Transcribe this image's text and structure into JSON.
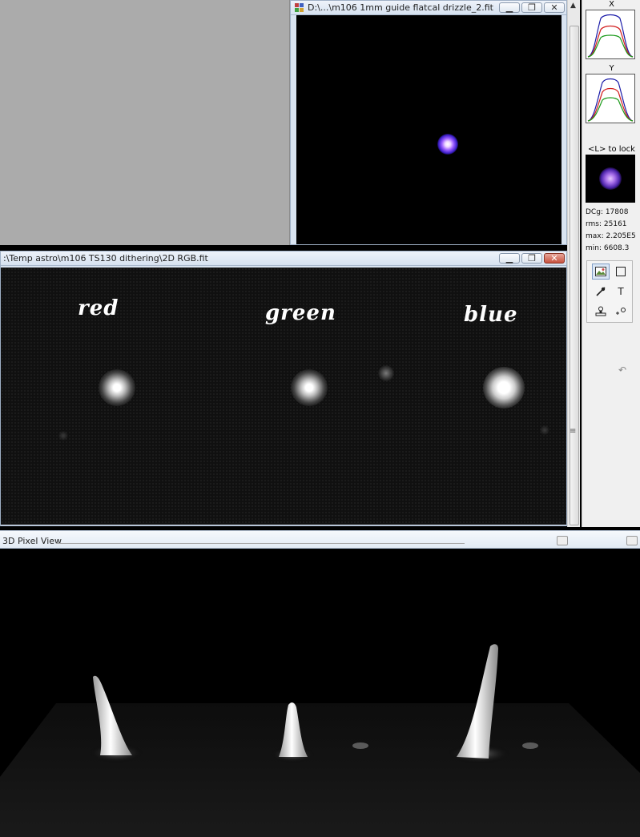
{
  "drizzle_window": {
    "title": "D:\\...\\m106 1mm guide flatcal drizzle_2.fit",
    "minimize_icon": "minimize-icon",
    "maximize_icon": "maximize-icon",
    "close_icon": "close-icon"
  },
  "rgb_window": {
    "title": ":\\Temp astro\\m106 TS130 dithering\\2D RGB.fit",
    "labels": {
      "red": "red",
      "green": "green",
      "blue": "blue"
    }
  },
  "sidebar": {
    "x_label": "X",
    "y_label": "Y",
    "lock_label": "<L> to lock",
    "stats": {
      "dcg": "DCg: 17808",
      "rms": "rms: 25161",
      "max": "max: 2.205E5",
      "min": "min: 6608.3"
    },
    "tools": [
      "image-tool-icon",
      "rectangle-tool-icon",
      "pin-tool-icon",
      "text-tool-icon",
      "stamp-tool-icon",
      "star-marker-tool-icon"
    ],
    "text_tool_glyph": "T"
  },
  "view3d_window": {
    "title": "3D Pixel View"
  },
  "colors": {
    "mdi_background": "#ababab",
    "profile_blue": "#1a1aa8",
    "profile_red": "#d21d1d",
    "profile_green": "#1a9a1a"
  }
}
